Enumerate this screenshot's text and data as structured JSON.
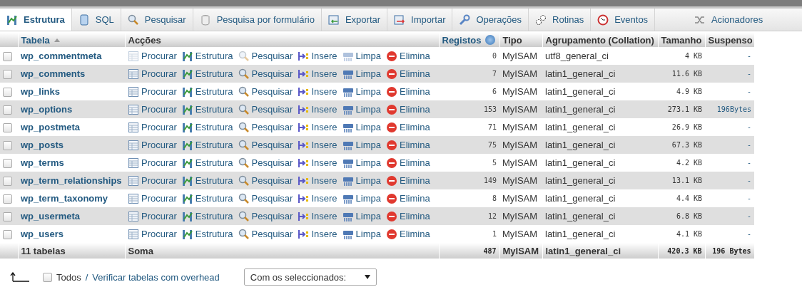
{
  "tabs": [
    {
      "kind": "structure",
      "label": "Estrutura",
      "selected": true
    },
    {
      "kind": "sql",
      "label": "SQL",
      "selected": false
    },
    {
      "kind": "search",
      "label": "Pesquisar",
      "selected": false
    },
    {
      "kind": "query",
      "label": "Pesquisa por formulário",
      "selected": false
    },
    {
      "kind": "export",
      "label": "Exportar",
      "selected": false
    },
    {
      "kind": "import",
      "label": "Importar",
      "selected": false
    },
    {
      "kind": "operations",
      "label": "Operações",
      "selected": false
    },
    {
      "kind": "routines",
      "label": "Rotinas",
      "selected": false
    },
    {
      "kind": "events",
      "label": "Eventos",
      "selected": false
    },
    {
      "kind": "triggers",
      "label": "Acionadores",
      "selected": false
    }
  ],
  "table": {
    "columns": [
      {
        "label": "Tabela",
        "sorted_ascending": true
      },
      {
        "label": "Acções"
      },
      {
        "label": "Registos",
        "help": true
      },
      {
        "label": "Tipo"
      },
      {
        "label": "Agrupamento (Collation)"
      },
      {
        "label": "Tamanho"
      },
      {
        "label": "Suspenso"
      }
    ],
    "rows": [
      {
        "checked": false,
        "name": "wp_commentmeta",
        "empty": true,
        "actions": [
          {
            "kind": "browse",
            "label": "Procurar"
          },
          {
            "kind": "structure",
            "label": "Estrutura"
          },
          {
            "kind": "search",
            "label": "Pesquisar"
          },
          {
            "kind": "insert",
            "label": "Insere"
          },
          {
            "kind": "empty",
            "label": "Limpa"
          },
          {
            "kind": "drop",
            "label": "Elimina"
          }
        ],
        "records": "0",
        "type": "MyISAM",
        "collation": "utf8_general_ci",
        "size": "4",
        "unit": "KB",
        "overhead": "-"
      },
      {
        "checked": false,
        "name": "wp_comments",
        "empty": false,
        "actions": [
          {
            "kind": "browse",
            "label": "Procurar"
          },
          {
            "kind": "structure",
            "label": "Estrutura"
          },
          {
            "kind": "search",
            "label": "Pesquisar"
          },
          {
            "kind": "insert",
            "label": "Insere"
          },
          {
            "kind": "empty",
            "label": "Limpa"
          },
          {
            "kind": "drop",
            "label": "Elimina"
          }
        ],
        "records": "7",
        "type": "MyISAM",
        "collation": "latin1_general_ci",
        "size": "11.6",
        "unit": "KB",
        "overhead": "-"
      },
      {
        "checked": false,
        "name": "wp_links",
        "empty": false,
        "actions": [
          {
            "kind": "browse",
            "label": "Procurar"
          },
          {
            "kind": "structure",
            "label": "Estrutura"
          },
          {
            "kind": "search",
            "label": "Pesquisar"
          },
          {
            "kind": "insert",
            "label": "Insere"
          },
          {
            "kind": "empty",
            "label": "Limpa"
          },
          {
            "kind": "drop",
            "label": "Elimina"
          }
        ],
        "records": "6",
        "type": "MyISAM",
        "collation": "latin1_general_ci",
        "size": "4.9",
        "unit": "KB",
        "overhead": "-"
      },
      {
        "checked": false,
        "name": "wp_options",
        "empty": false,
        "actions": [
          {
            "kind": "browse",
            "label": "Procurar"
          },
          {
            "kind": "structure",
            "label": "Estrutura"
          },
          {
            "kind": "search",
            "label": "Pesquisar"
          },
          {
            "kind": "insert",
            "label": "Insere"
          },
          {
            "kind": "empty",
            "label": "Limpa"
          },
          {
            "kind": "drop",
            "label": "Elimina"
          }
        ],
        "records": "153",
        "type": "MyISAM",
        "collation": "latin1_general_ci",
        "size": "273.1",
        "unit": "KB",
        "overhead": "196Bytes"
      },
      {
        "checked": false,
        "name": "wp_postmeta",
        "empty": false,
        "actions": [
          {
            "kind": "browse",
            "label": "Procurar"
          },
          {
            "kind": "structure",
            "label": "Estrutura"
          },
          {
            "kind": "search",
            "label": "Pesquisar"
          },
          {
            "kind": "insert",
            "label": "Insere"
          },
          {
            "kind": "empty",
            "label": "Limpa"
          },
          {
            "kind": "drop",
            "label": "Elimina"
          }
        ],
        "records": "71",
        "type": "MyISAM",
        "collation": "latin1_general_ci",
        "size": "26.9",
        "unit": "KB",
        "overhead": "-"
      },
      {
        "checked": false,
        "name": "wp_posts",
        "empty": false,
        "actions": [
          {
            "kind": "browse",
            "label": "Procurar"
          },
          {
            "kind": "structure",
            "label": "Estrutura"
          },
          {
            "kind": "search",
            "label": "Pesquisar"
          },
          {
            "kind": "insert",
            "label": "Insere"
          },
          {
            "kind": "empty",
            "label": "Limpa"
          },
          {
            "kind": "drop",
            "label": "Elimina"
          }
        ],
        "records": "75",
        "type": "MyISAM",
        "collation": "latin1_general_ci",
        "size": "67.3",
        "unit": "KB",
        "overhead": "-"
      },
      {
        "checked": false,
        "name": "wp_terms",
        "empty": false,
        "actions": [
          {
            "kind": "browse",
            "label": "Procurar"
          },
          {
            "kind": "structure",
            "label": "Estrutura"
          },
          {
            "kind": "search",
            "label": "Pesquisar"
          },
          {
            "kind": "insert",
            "label": "Insere"
          },
          {
            "kind": "empty",
            "label": "Limpa"
          },
          {
            "kind": "drop",
            "label": "Elimina"
          }
        ],
        "records": "5",
        "type": "MyISAM",
        "collation": "latin1_general_ci",
        "size": "4.2",
        "unit": "KB",
        "overhead": "-"
      },
      {
        "checked": false,
        "name": "wp_term_relationships",
        "empty": false,
        "actions": [
          {
            "kind": "browse",
            "label": "Procurar"
          },
          {
            "kind": "structure",
            "label": "Estrutura"
          },
          {
            "kind": "search",
            "label": "Pesquisar"
          },
          {
            "kind": "insert",
            "label": "Insere"
          },
          {
            "kind": "empty",
            "label": "Limpa"
          },
          {
            "kind": "drop",
            "label": "Elimina"
          }
        ],
        "records": "149",
        "type": "MyISAM",
        "collation": "latin1_general_ci",
        "size": "13.1",
        "unit": "KB",
        "overhead": "-"
      },
      {
        "checked": false,
        "name": "wp_term_taxonomy",
        "empty": false,
        "actions": [
          {
            "kind": "browse",
            "label": "Procurar"
          },
          {
            "kind": "structure",
            "label": "Estrutura"
          },
          {
            "kind": "search",
            "label": "Pesquisar"
          },
          {
            "kind": "insert",
            "label": "Insere"
          },
          {
            "kind": "empty",
            "label": "Limpa"
          },
          {
            "kind": "drop",
            "label": "Elimina"
          }
        ],
        "records": "8",
        "type": "MyISAM",
        "collation": "latin1_general_ci",
        "size": "4.4",
        "unit": "KB",
        "overhead": "-"
      },
      {
        "checked": false,
        "name": "wp_usermeta",
        "empty": false,
        "actions": [
          {
            "kind": "browse",
            "label": "Procurar"
          },
          {
            "kind": "structure",
            "label": "Estrutura"
          },
          {
            "kind": "search",
            "label": "Pesquisar"
          },
          {
            "kind": "insert",
            "label": "Insere"
          },
          {
            "kind": "empty",
            "label": "Limpa"
          },
          {
            "kind": "drop",
            "label": "Elimina"
          }
        ],
        "records": "12",
        "type": "MyISAM",
        "collation": "latin1_general_ci",
        "size": "6.8",
        "unit": "KB",
        "overhead": "-"
      },
      {
        "checked": false,
        "name": "wp_users",
        "empty": false,
        "actions": [
          {
            "kind": "browse",
            "label": "Procurar"
          },
          {
            "kind": "structure",
            "label": "Estrutura"
          },
          {
            "kind": "search",
            "label": "Pesquisar"
          },
          {
            "kind": "insert",
            "label": "Insere"
          },
          {
            "kind": "empty",
            "label": "Limpa"
          },
          {
            "kind": "drop",
            "label": "Elimina"
          }
        ],
        "records": "1",
        "type": "MyISAM",
        "collation": "latin1_general_ci",
        "size": "4.1",
        "unit": "KB",
        "overhead": "-"
      }
    ],
    "footer": {
      "count": "11 tabelas",
      "label": "Soma",
      "records": "487",
      "type": "MyISAM",
      "collation": "latin1_general_ci",
      "size": "420.3",
      "unit": "KB",
      "overhead": "196 Bytes"
    }
  },
  "bottom": {
    "checked": false,
    "all_label": "Todos",
    "separator": "/",
    "link": "Verificar tabelas com overhead",
    "select": "Com os seleccionados:"
  }
}
